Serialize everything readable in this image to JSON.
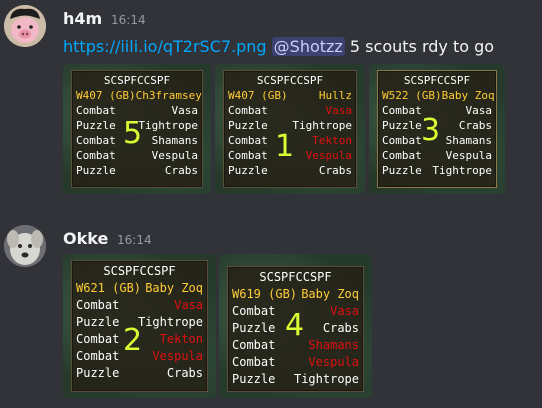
{
  "messages": [
    {
      "username": "h4m",
      "timestamp": "16:14",
      "link": "https://iili.io/qT2rSC7.png",
      "mention": "@Shotzz",
      "text": " 5 scouts rdy to go",
      "images": [
        {
          "title": "SCSPFCCSPF",
          "world": "W407 (GB)",
          "player": "Ch3framsey",
          "digit": "5",
          "rows": [
            {
              "left": "Combat",
              "right": "Vasa",
              "danger": false
            },
            {
              "left": "Puzzle",
              "right": "Tightrope",
              "danger": false
            },
            {
              "left": "Combat",
              "right": "Shamans",
              "danger": false
            },
            {
              "left": "Combat",
              "right": "Vespula",
              "danger": false
            },
            {
              "left": "Puzzle",
              "right": "Crabs",
              "danger": false
            }
          ]
        },
        {
          "title": "SCSPFCCSPF",
          "world": "W407 (GB)",
          "player": "Hullz",
          "digit": "1",
          "rows": [
            {
              "left": "Combat",
              "right": "Vasa",
              "danger": true
            },
            {
              "left": "Puzzle",
              "right": "Tightrope",
              "danger": false
            },
            {
              "left": "Combat",
              "right": "Tekton",
              "danger": true
            },
            {
              "left": "Combat",
              "right": "Vespula",
              "danger": true
            },
            {
              "left": "Puzzle",
              "right": "Crabs",
              "danger": false
            }
          ]
        },
        {
          "title": "SCSPFCCSPF",
          "world": "W522 (GB)",
          "player": "Baby Zoq",
          "digit": "3",
          "rows": [
            {
              "left": "Combat",
              "right": "Vasa",
              "danger": false
            },
            {
              "left": "Puzzle",
              "right": "Crabs",
              "danger": false
            },
            {
              "left": "Combat",
              "right": "Shamans",
              "danger": false
            },
            {
              "left": "Combat",
              "right": "Vespula",
              "danger": false
            },
            {
              "left": "Puzzle",
              "right": "Tightrope",
              "danger": false
            }
          ]
        }
      ]
    },
    {
      "username": "Okke",
      "timestamp": "16:14",
      "images": [
        {
          "title": "SCSPFCCSPF",
          "world": "W621 (GB)",
          "player": "Baby Zoq",
          "digit": "2",
          "rows": [
            {
              "left": "Combat",
              "right": "Vasa",
              "danger": true
            },
            {
              "left": "Puzzle",
              "right": "Tightrope",
              "danger": false
            },
            {
              "left": "Combat",
              "right": "Tekton",
              "danger": true
            },
            {
              "left": "Combat",
              "right": "Vespula",
              "danger": true
            },
            {
              "left": "Puzzle",
              "right": "Crabs",
              "danger": false
            }
          ]
        },
        {
          "title": "SCSPFCCSPF",
          "world": "W619 (GB)",
          "player": "Baby Zoq",
          "digit": "4",
          "rows": [
            {
              "left": "Combat",
              "right": "Vasa",
              "danger": true
            },
            {
              "left": "Puzzle",
              "right": "Crabs",
              "danger": false
            },
            {
              "left": "Combat",
              "right": "Shamans",
              "danger": true
            },
            {
              "left": "Combat",
              "right": "Vespula",
              "danger": true
            },
            {
              "left": "Puzzle",
              "right": "Tightrope",
              "danger": false
            }
          ]
        }
      ]
    }
  ],
  "colors": {
    "background": "#313338",
    "link": "#00a8fc",
    "mention_bg": "#3c4270",
    "overlay_yellow": "#ffcd34",
    "overlay_red": "#e01010",
    "handwritten_digit": "#d8ff33"
  },
  "icons": [
    "avatar-pig",
    "avatar-dog"
  ]
}
